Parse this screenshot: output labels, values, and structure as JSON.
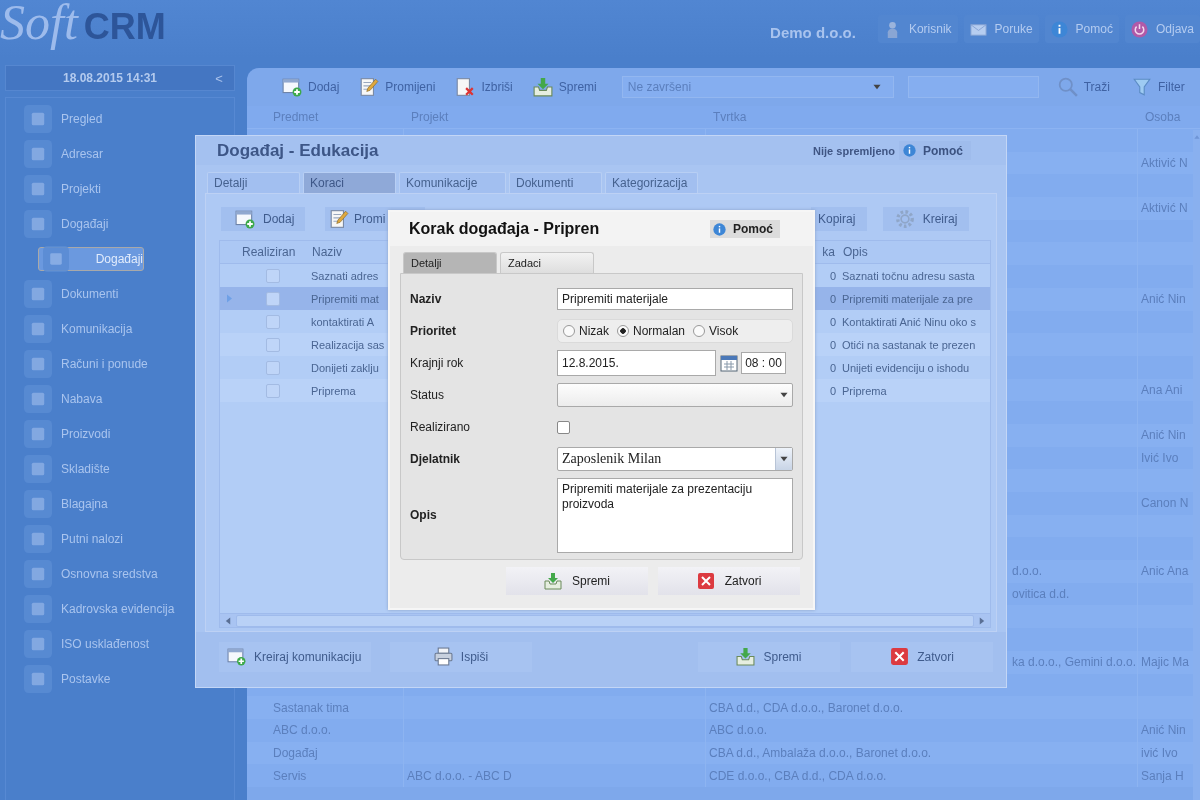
{
  "header": {
    "logo": {
      "script": "Soft",
      "bold": "CRM"
    },
    "company": "Demo d.o.o.",
    "buttons": [
      {
        "label": "Korisnik",
        "kind": "user"
      },
      {
        "label": "Poruke",
        "kind": "messages"
      },
      {
        "label": "Pomoć",
        "kind": "help"
      },
      {
        "label": "Odjava",
        "kind": "logout"
      }
    ]
  },
  "sidebar": {
    "datetime": "18.08.2015 14:31",
    "collapse": "<",
    "items": [
      {
        "label": "Pregled",
        "selected": false
      },
      {
        "label": "Adresar",
        "selected": false
      },
      {
        "label": "Projekti",
        "selected": false
      },
      {
        "label": "Događaji",
        "selected": false,
        "children": [
          {
            "label": "Događaji",
            "selected": true
          }
        ]
      },
      {
        "label": "Dokumenti",
        "selected": false
      },
      {
        "label": "Komunikacija",
        "selected": false
      },
      {
        "label": "Računi i ponude",
        "selected": false
      },
      {
        "label": "Nabava",
        "selected": false
      },
      {
        "label": "Proizvodi",
        "selected": false
      },
      {
        "label": "Skladište",
        "selected": false
      },
      {
        "label": "Blagajna",
        "selected": false
      },
      {
        "label": "Putni nalozi",
        "selected": false
      },
      {
        "label": "Osnovna sredstva",
        "selected": false
      },
      {
        "label": "Kadrovska evidencija",
        "selected": false
      },
      {
        "label": "ISO usklađenost",
        "selected": false
      },
      {
        "label": "Postavke",
        "selected": false
      }
    ]
  },
  "toolbar": {
    "buttons": [
      {
        "label": "Dodaj",
        "kind": "add"
      },
      {
        "label": "Promijeni",
        "kind": "edit"
      },
      {
        "label": "Izbriši",
        "kind": "delete"
      },
      {
        "label": "Spremi",
        "kind": "save"
      }
    ],
    "filter_select": "Ne završeni",
    "tools": [
      {
        "label": "Traži",
        "kind": "search"
      },
      {
        "label": "Filter",
        "kind": "filter"
      }
    ]
  },
  "table": {
    "columns": [
      "Predmet",
      "Projekt",
      "Tvrtka",
      "Osoba"
    ],
    "rows": [
      {
        "kind": "covered"
      },
      {
        "kind": "covered",
        "osoba": "Aktivić N"
      },
      {
        "kind": "covered"
      },
      {
        "kind": "covered",
        "osoba": "Aktivić N"
      },
      {
        "kind": "covered"
      },
      {
        "kind": "covered"
      },
      {
        "kind": "covered"
      },
      {
        "kind": "covered",
        "osoba": "Anić Nin"
      },
      {
        "kind": "covered"
      },
      {
        "kind": "covered"
      },
      {
        "kind": "covered"
      },
      {
        "kind": "covered",
        "osoba": "Ana Ani"
      },
      {
        "kind": "covered"
      },
      {
        "kind": "covered",
        "osoba": "Anić Nin"
      },
      {
        "kind": "covered",
        "osoba": "Ivić Ivo"
      },
      {
        "kind": "covered"
      },
      {
        "kind": "covered",
        "osoba": "Canon N"
      },
      {
        "kind": "covered"
      },
      {
        "kind": "covered"
      },
      {
        "kind": "covered",
        "tvrtka": "d.o.o.",
        "osoba": "Anic Ana"
      },
      {
        "kind": "covered",
        "tvrtka": "ovitica d.d."
      },
      {
        "kind": "covered"
      },
      {
        "kind": "covered"
      },
      {
        "kind": "covered",
        "tvrtka": "ka d.o.o., Gemini d.o.o.",
        "osoba": "Majic Ma"
      },
      {
        "kind": "covered"
      },
      {
        "kind": "open",
        "predmet": "Sastanak tima",
        "tvrtka": "CBA d.d., CDA d.o.o., Baronet d.o.o."
      },
      {
        "kind": "open",
        "predmet": "ABC d.o.o.",
        "tvrtka": "ABC d.o.o.",
        "osoba": "Anić Nin"
      },
      {
        "kind": "open",
        "predmet": "Događaj",
        "tvrtka": "CBA d.d., Ambalaža d.o.o., Baronet d.o.o.",
        "osoba": "ivić Ivo"
      },
      {
        "kind": "open",
        "predmet": "Servis",
        "projekt": "ABC d.o.o. - ABC D",
        "tvrtka": "CDE d.o.o., CBA d.d., CDA d.o.o.",
        "osoba": "Sanja H"
      }
    ]
  },
  "event_dialog": {
    "title": "Događaj - Edukacija",
    "status": "Nije spremljeno",
    "help": "Pomoć",
    "tabs": [
      {
        "label": "Detalji",
        "selected": false
      },
      {
        "label": "Koraci",
        "selected": true
      },
      {
        "label": "Komunikacije",
        "selected": false
      },
      {
        "label": "Dokumenti",
        "selected": false
      },
      {
        "label": "Kategorizacija",
        "selected": false
      }
    ],
    "toolbar": [
      {
        "label": "Dodaj",
        "kind": "add"
      },
      {
        "label": "Promi",
        "kind": "edit"
      },
      {
        "label": "Kopiraj",
        "kind": "copy"
      },
      {
        "label": "Kreiraj",
        "kind": "create"
      }
    ],
    "steps": {
      "columns": [
        "Realiziran",
        "Naziv",
        "ka",
        "Opis"
      ],
      "rows": [
        {
          "selected": false,
          "done": false,
          "name": "Saznati adres",
          "count": "0",
          "description": "Saznati točnu adresu sasta"
        },
        {
          "selected": true,
          "done": false,
          "name": "Pripremiti mat",
          "count": "0",
          "description": "Pripremiti materijale za pre"
        },
        {
          "selected": false,
          "done": false,
          "name": "kontaktirati A",
          "count": "0",
          "description": "Kontaktirati Anić Ninu oko s"
        },
        {
          "selected": false,
          "done": false,
          "name": "Realizacija sas",
          "count": "0",
          "description": "Otići na sastanak te prezen"
        },
        {
          "selected": false,
          "done": false,
          "name": "Donijeti zaklju",
          "count": "0",
          "description": "Unijeti evidenciju o ishodu"
        },
        {
          "selected": false,
          "done": false,
          "name": "Priprema",
          "count": "0",
          "description": "Priprema"
        }
      ]
    },
    "footer": [
      {
        "label": "Kreiraj komunikaciju",
        "kind": "communicate"
      },
      {
        "label": "Ispiši",
        "kind": "print"
      },
      {
        "label": "Spremi",
        "kind": "save"
      },
      {
        "label": "Zatvori",
        "kind": "close"
      }
    ]
  },
  "step_dialog": {
    "title": "Korak događaja - Pripren",
    "help": "Pomoć",
    "tabs": [
      {
        "label": "Detalji",
        "selected": true
      },
      {
        "label": "Zadaci",
        "selected": false
      }
    ],
    "fields": [
      {
        "label": "Naziv",
        "required": true,
        "kind": "text",
        "value": "Pripremiti materijale"
      },
      {
        "label": "Prioritet",
        "required": true,
        "kind": "radio",
        "options": [
          {
            "label": "Nizak",
            "selected": false
          },
          {
            "label": "Normalan",
            "selected": true
          },
          {
            "label": "Visok",
            "selected": false
          }
        ]
      },
      {
        "label": "Krajnji rok",
        "required": false,
        "kind": "datetime",
        "date": "12.8.2015.",
        "time": "08 : 00"
      },
      {
        "label": "Status",
        "required": false,
        "kind": "select"
      },
      {
        "label": "Realizirano",
        "required": false,
        "kind": "checkbox",
        "checked": false
      },
      {
        "label": "Djelatnik",
        "required": true,
        "kind": "select",
        "value": "Zaposlenik Milan"
      },
      {
        "label": "Opis",
        "required": true,
        "kind": "textarea",
        "value": "Pripremiti materijale za prezentaciju proizvoda"
      }
    ],
    "buttons": [
      {
        "label": "Spremi",
        "kind": "save"
      },
      {
        "label": "Zatvori",
        "kind": "close"
      }
    ]
  }
}
